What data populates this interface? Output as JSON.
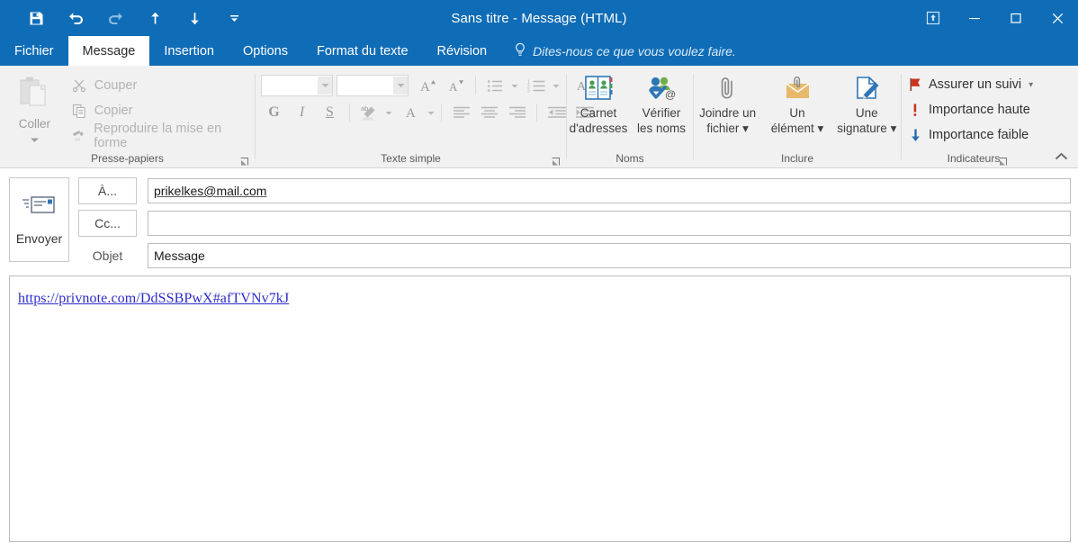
{
  "window": {
    "title": "Sans titre - Message (HTML)",
    "accent_color": "#0f6cb6",
    "quick_access": [
      {
        "name": "save-icon",
        "label": "Enregistrer",
        "enabled": true
      },
      {
        "name": "undo-icon",
        "label": "Annuler",
        "enabled": true
      },
      {
        "name": "redo-icon",
        "label": "Rétablir",
        "enabled": false
      },
      {
        "name": "previous-item-icon",
        "label": "Élément précédent",
        "enabled": true
      },
      {
        "name": "next-item-icon",
        "label": "Élément suivant",
        "enabled": true
      },
      {
        "name": "customize-qat-icon",
        "label": "Personnaliser la barre d'outils Accès rapide",
        "enabled": true
      }
    ],
    "controls": {
      "ribbon_display": "Options d'affichage du ruban",
      "minimize": "Réduire",
      "maximize": "Agrandir",
      "close": "Fermer"
    }
  },
  "tabs": [
    {
      "label": "Fichier",
      "active": false
    },
    {
      "label": "Message",
      "active": true
    },
    {
      "label": "Insertion",
      "active": false
    },
    {
      "label": "Options",
      "active": false
    },
    {
      "label": "Format du texte",
      "active": false
    },
    {
      "label": "Révision",
      "active": false
    }
  ],
  "tell_me": {
    "icon": "lightbulb-icon",
    "placeholder": "Dites-nous ce que vous voulez faire."
  },
  "ribbon": {
    "collapse_label": "Réduire le ruban",
    "groups": [
      {
        "name": "clipboard",
        "label": "Presse-papiers",
        "has_dialog_launcher": true,
        "paste": {
          "label": "Coller",
          "icon": "clipboard-icon",
          "enabled": false,
          "has_caret": true
        },
        "commands": [
          {
            "label": "Couper",
            "icon": "scissors-icon",
            "enabled": false
          },
          {
            "label": "Copier",
            "icon": "copy-icon",
            "enabled": false
          },
          {
            "label": "Reproduire la mise en forme",
            "icon": "format-painter-icon",
            "enabled": false
          }
        ]
      },
      {
        "name": "text",
        "label": "Texte simple",
        "has_dialog_launcher": true,
        "font_name": {
          "value": "",
          "placeholder": ""
        },
        "font_size": {
          "value": "",
          "placeholder": ""
        },
        "row1": [
          {
            "label": "Augmenter la taille de police",
            "icon": "grow-font-icon"
          },
          {
            "label": "Réduire la taille de police",
            "icon": "shrink-font-icon"
          },
          {
            "label": "Puces",
            "icon": "bullets-icon",
            "has_caret": true
          },
          {
            "label": "Numérotation",
            "icon": "numbering-icon",
            "has_caret": true
          },
          {
            "label": "Effacer la mise en forme",
            "icon": "clear-formatting-icon"
          }
        ],
        "row2": [
          {
            "label": "Gras",
            "icon": "bold-icon",
            "glyph": "G"
          },
          {
            "label": "Italique",
            "icon": "italic-icon",
            "glyph": "I"
          },
          {
            "label": "Souligné",
            "icon": "underline-icon",
            "glyph": "S"
          },
          {
            "label": "Couleur de surbrillance du texte",
            "icon": "text-highlight-icon",
            "has_caret": true
          },
          {
            "label": "Couleur de police",
            "icon": "font-color-icon",
            "has_caret": true
          },
          {
            "label": "Aligner à gauche",
            "icon": "align-left-icon"
          },
          {
            "label": "Centrer",
            "icon": "align-center-icon"
          },
          {
            "label": "Aligner à droite",
            "icon": "align-right-icon"
          },
          {
            "label": "Diminuer le retrait",
            "icon": "decrease-indent-icon"
          },
          {
            "label": "Augmenter le retrait",
            "icon": "increase-indent-icon"
          }
        ]
      },
      {
        "name": "names",
        "label": "Noms",
        "has_dialog_launcher": false,
        "buttons": [
          {
            "label": "Carnet\nd'adresses",
            "line1": "Carnet",
            "line2": "d'adresses",
            "icon": "address-book-icon",
            "has_caret": false
          },
          {
            "label": "Vérifier les noms",
            "line1": "Vérifier",
            "line2": "les noms",
            "icon": "check-names-icon",
            "has_caret": false
          }
        ]
      },
      {
        "name": "include",
        "label": "Inclure",
        "has_dialog_launcher": false,
        "buttons": [
          {
            "line1": "Joindre un",
            "line2": "fichier",
            "icon": "paperclip-icon",
            "has_caret": true
          },
          {
            "line1": "Un",
            "line2": "élément",
            "icon": "attach-item-icon",
            "has_caret": true
          },
          {
            "line1": "Une",
            "line2": "signature",
            "icon": "signature-icon",
            "has_caret": true
          }
        ]
      },
      {
        "name": "tags",
        "label": "Indicateurs",
        "has_dialog_launcher": true,
        "commands": [
          {
            "label": "Assurer un suivi",
            "icon": "flag-icon",
            "color": "#c8341f",
            "has_caret": true
          },
          {
            "label": "Importance haute",
            "icon": "exclamation-icon",
            "color": "#c8341f",
            "has_caret": false
          },
          {
            "label": "Importance faible",
            "icon": "down-arrow-icon",
            "color": "#2b6cb0",
            "has_caret": false
          }
        ]
      }
    ]
  },
  "compose": {
    "send_button": {
      "label": "Envoyer",
      "icon": "send-envelope-icon"
    },
    "to": {
      "button_label": "À...",
      "value": "prikelkes@mail.com",
      "placeholder": ""
    },
    "cc": {
      "button_label": "Cc...",
      "value": "",
      "placeholder": ""
    },
    "subject": {
      "label": "Objet",
      "value": "Message",
      "placeholder": ""
    },
    "body": {
      "link_text": "https://privnote.com/DdSSBPwX#afTVNv7kJ",
      "link_color": "#2b2bc8"
    }
  }
}
